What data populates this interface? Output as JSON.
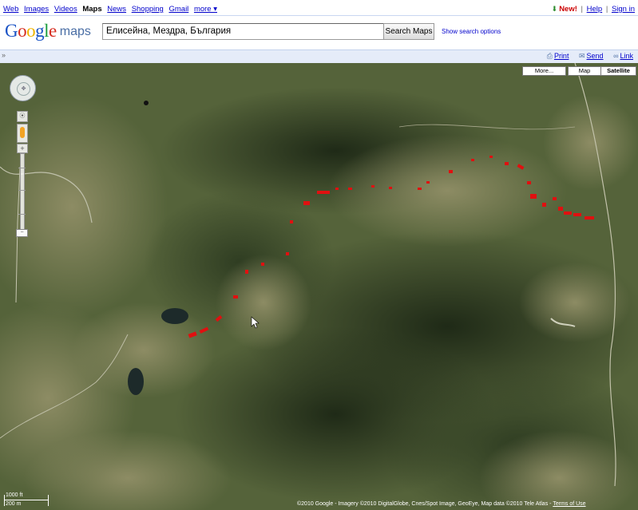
{
  "gbar": {
    "links": [
      "Web",
      "Images",
      "Videos",
      "Maps",
      "News",
      "Shopping",
      "Gmail",
      "more ▾"
    ],
    "current": "Maps",
    "new_label": "New!",
    "help": "Help",
    "signin": "Sign in",
    "separator": "|"
  },
  "header": {
    "logo_text": "Google",
    "product": "maps",
    "search_value": "Елисейна, Мездра, България",
    "search_button": "Search Maps",
    "options_link": "Show search options"
  },
  "toolbar": {
    "collapse": "»",
    "print": "Print",
    "send": "Send",
    "link": "Link"
  },
  "map": {
    "type_buttons": [
      "More...",
      "Map",
      "Satellite"
    ],
    "active_type": "Satellite",
    "scale_ft": "1000 ft",
    "scale_m": "200 m",
    "copyright": "©2010 Google - Imagery ©2010 DigitalGlobe, Cnes/Spot Image, GeoEye, Map data ©2010 Tele Atlas -",
    "terms": "Terms of Use"
  },
  "colors": {
    "link": "#0000cc",
    "toolbar_bg": "#e5ecf9",
    "route": "#e01010"
  }
}
